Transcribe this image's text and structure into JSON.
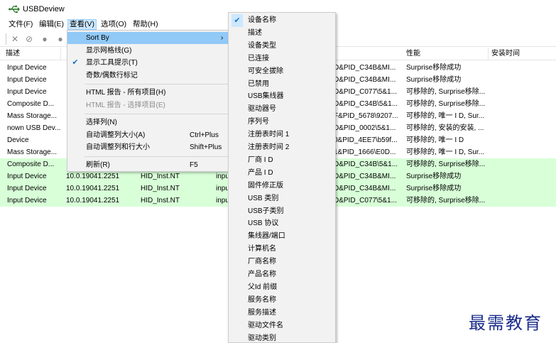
{
  "app": {
    "title": "USBDeview"
  },
  "menubar": [
    {
      "label": "文件(F)"
    },
    {
      "label": "编辑(E)"
    },
    {
      "label": "查看(V)"
    },
    {
      "label": "选项(O)"
    },
    {
      "label": "帮助(H)"
    }
  ],
  "toolbar": {
    "icons": [
      "close-icon",
      "uninstall-icon",
      "disable-icon",
      "enable-icon"
    ]
  },
  "table": {
    "columns": [
      "描述",
      "性能",
      "安装时间"
    ],
    "rows": [
      {
        "name": "Input Device",
        "driver_ver": "",
        "inf": "",
        "class": "",
        "id": "D&PID_C34B&MI...",
        "caps": "Surprise移除成功",
        "green": false
      },
      {
        "name": "Input Device",
        "driver_ver": "",
        "inf": "",
        "class": "",
        "id": "D&PID_C34B&MI...",
        "caps": "Surprise移除成功",
        "green": false
      },
      {
        "name": "Input Device",
        "driver_ver": "",
        "inf": "",
        "class": "",
        "id": "D&PID_C077\\5&1...",
        "caps": "可移除的, Surprise移除...",
        "green": false
      },
      {
        "name": "Composite D...",
        "driver_ver": "",
        "inf": "",
        "class": "",
        "id": "D&PID_C34B\\5&1...",
        "caps": "可移除的, Surprise移除...",
        "green": false
      },
      {
        "name": "Mass Storage...",
        "driver_ver": "",
        "inf": "",
        "class": "",
        "id": "F&PID_5678\\9207...",
        "caps": "可移除的, 唯一 I D, Sur...",
        "green": false
      },
      {
        "name": "nown USB Dev...",
        "driver_ver": "",
        "inf": "",
        "class": "",
        "id": "D&PID_0002\\5&1...",
        "caps": "可移除的, 安装的安装, ...",
        "green": false
      },
      {
        "name": "Device",
        "driver_ver": "",
        "inf": "",
        "class": "",
        "id": "0&PID_4EE7\\b59f...",
        "caps": "可移除的, 唯一 I D",
        "green": false
      },
      {
        "name": "Mass Storage...",
        "driver_ver": "",
        "inf": "",
        "class": "",
        "id": "1&PID_1666\\E0D...",
        "caps": "可移除的, 唯一 I D, Sur...",
        "green": false
      },
      {
        "name": "Composite D...",
        "driver_ver": "",
        "inf": "",
        "class": "",
        "id": "D&PID_C34B\\5&1...",
        "caps": "可移除的, Surprise移除...",
        "green": true
      },
      {
        "name": "Input Device",
        "driver_ver": "10.0.19041.2251",
        "inf": "HID_Inst.NT",
        "class": "inpu",
        "id": "D&PID_C34B&MI...",
        "caps": "Surprise移除成功",
        "green": true
      },
      {
        "name": "Input Device",
        "driver_ver": "10.0.19041.2251",
        "inf": "HID_Inst.NT",
        "class": "inpu",
        "id": "D&PID_C34B&MI...",
        "caps": "Surprise移除成功",
        "green": true
      },
      {
        "name": "Input Device",
        "driver_ver": "10.0.19041.2251",
        "inf": "HID_Inst.NT",
        "class": "inpu",
        "id": "D&PID_C077\\5&1...",
        "caps": "可移除的, Surprise移除...",
        "green": true
      }
    ]
  },
  "view_menu": {
    "items": [
      {
        "label": "Sort By",
        "shortcut": "",
        "checked": false,
        "submenu": true,
        "hover": true,
        "disabled": false
      },
      {
        "label": "显示网格线(G)",
        "shortcut": "",
        "checked": false,
        "submenu": false,
        "hover": false,
        "disabled": false
      },
      {
        "label": "显示工具提示(T)",
        "shortcut": "",
        "checked": true,
        "submenu": false,
        "hover": false,
        "disabled": false
      },
      {
        "label": "奇数/偶数行标记",
        "shortcut": "",
        "checked": false,
        "submenu": false,
        "hover": false,
        "disabled": false
      },
      {
        "separator": true
      },
      {
        "label": "HTML 报告 - 所有项目(H)",
        "shortcut": "",
        "checked": false,
        "submenu": false,
        "hover": false,
        "disabled": false
      },
      {
        "label": "HTML 报告 - 选择项目(E)",
        "shortcut": "",
        "checked": false,
        "submenu": false,
        "hover": false,
        "disabled": true
      },
      {
        "separator": true
      },
      {
        "label": "选择列(N)",
        "shortcut": "",
        "checked": false,
        "submenu": false,
        "hover": false,
        "disabled": false
      },
      {
        "label": "自动调整列大小(A)",
        "shortcut": "Ctrl+Plus",
        "checked": false,
        "submenu": false,
        "hover": false,
        "disabled": false
      },
      {
        "label": "自动调整列和行大小",
        "shortcut": "Shift+Plus",
        "checked": false,
        "submenu": false,
        "hover": false,
        "disabled": false
      },
      {
        "separator": true
      },
      {
        "label": "刷新(R)",
        "shortcut": "F5",
        "checked": false,
        "submenu": false,
        "hover": false,
        "disabled": false
      }
    ]
  },
  "sort_submenu": {
    "items": [
      {
        "label": "设备名称",
        "checked": true
      },
      {
        "label": "描述",
        "checked": false
      },
      {
        "label": "设备类型",
        "checked": false
      },
      {
        "label": "已连接",
        "checked": false
      },
      {
        "label": "可安全拔除",
        "checked": false
      },
      {
        "label": "已禁用",
        "checked": false
      },
      {
        "label": "USB集线器",
        "checked": false
      },
      {
        "label": "驱动器号",
        "checked": false
      },
      {
        "label": "序列号",
        "checked": false
      },
      {
        "label": "注册表时间 1",
        "checked": false
      },
      {
        "label": "注册表时间 2",
        "checked": false
      },
      {
        "label": "厂商 I D",
        "checked": false
      },
      {
        "label": "产品 I D",
        "checked": false
      },
      {
        "label": "固件修正版",
        "checked": false
      },
      {
        "label": "USB 类别",
        "checked": false
      },
      {
        "label": "USB子类别",
        "checked": false
      },
      {
        "label": "USB 协议",
        "checked": false
      },
      {
        "label": "集线器/端口",
        "checked": false
      },
      {
        "label": "计算机名",
        "checked": false
      },
      {
        "label": "厂商名称",
        "checked": false
      },
      {
        "label": "产品名称",
        "checked": false
      },
      {
        "label": "父Id 前缀",
        "checked": false
      },
      {
        "label": "服务名称",
        "checked": false
      },
      {
        "label": "服务描述",
        "checked": false
      },
      {
        "label": "驱动文件名",
        "checked": false
      },
      {
        "label": "驱动类别",
        "checked": false
      }
    ]
  },
  "watermark": "最需教育"
}
